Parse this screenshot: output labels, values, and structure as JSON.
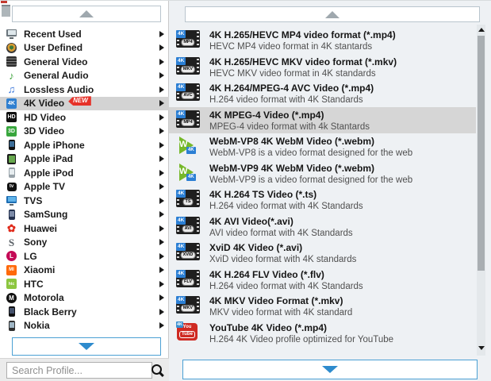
{
  "colors": {
    "accent_blue": "#3398dc",
    "chip_blue": "#2b7fd4",
    "selected_gray": "#d6d6d6",
    "badge_red": "#e63229",
    "panel_bg": "#eef1f4",
    "webm_green": "#76b82a",
    "youtube_red": "#cf2a22"
  },
  "left_panel": {
    "badge_new": "NEW",
    "search": {
      "placeholder": "Search Profile...",
      "icon": "search-icon"
    },
    "categories": [
      {
        "label": "Recent Used",
        "icon": "recent-used-icon",
        "kind": "monitor",
        "bg": "#6b757c",
        "screen": "#dfe8ec"
      },
      {
        "label": "User Defined",
        "icon": "user-defined-icon",
        "kind": "globe"
      },
      {
        "label": "General Video",
        "icon": "general-video-icon",
        "kind": "film"
      },
      {
        "label": "General Audio",
        "icon": "general-audio-icon",
        "kind": "note",
        "glyph": "♪",
        "fg": "#3fa33c"
      },
      {
        "label": "Lossless Audio",
        "icon": "lossless-audio-icon",
        "kind": "note",
        "glyph": "♫",
        "fg": "#2f6fd8"
      },
      {
        "label": "4K Video",
        "icon": "4k-video-icon",
        "kind": "square",
        "bg": "#2f7fd0",
        "glyph": "4K",
        "fsize": 7,
        "selected": true,
        "badge": "NEW"
      },
      {
        "label": "HD Video",
        "icon": "hd-video-icon",
        "kind": "square",
        "bg": "#101010",
        "glyph": "HD",
        "fsize": 7
      },
      {
        "label": "3D Video",
        "icon": "3d-video-icon",
        "kind": "square",
        "bg": "#38a63d",
        "glyph": "3D",
        "fsize": 7
      },
      {
        "label": "Apple iPhone",
        "icon": "apple-iphone-icon",
        "kind": "phone",
        "bg": "#101010",
        "screen": "#3d6e99"
      },
      {
        "label": "Apple iPad",
        "icon": "apple-ipad-icon",
        "kind": "tablet",
        "bg": "#1a1a1a",
        "screen": "#67a84e"
      },
      {
        "label": "Apple iPod",
        "icon": "apple-ipod-icon",
        "kind": "phone",
        "bg": "#98a2a9",
        "screen": "#e7edf0"
      },
      {
        "label": "Apple TV",
        "icon": "apple-tv-icon",
        "kind": "tvbox",
        "bg": "#101010",
        "glyph": "tv"
      },
      {
        "label": "TVS",
        "icon": "tvs-icon",
        "kind": "monitor",
        "bg": "#1d6db3",
        "screen": "#5fb2e8"
      },
      {
        "label": "SamSung",
        "icon": "samsung-icon",
        "kind": "phone",
        "bg": "#23304d",
        "screen": "#7c8ba8"
      },
      {
        "label": "Huawei",
        "icon": "huawei-icon",
        "kind": "note",
        "glyph": "✿",
        "fg": "#e02a1a"
      },
      {
        "label": "Sony",
        "icon": "sony-icon",
        "kind": "letter",
        "glyph": "S",
        "fg": "#5a6066"
      },
      {
        "label": "LG",
        "icon": "lg-icon",
        "kind": "circle",
        "bg": "#c40a56",
        "glyph": "L",
        "fsize": 8
      },
      {
        "label": "Xiaomi",
        "icon": "xiaomi-icon",
        "kind": "square",
        "bg": "#ff6909",
        "glyph": "MI",
        "fsize": 6
      },
      {
        "label": "HTC",
        "icon": "htc-icon",
        "kind": "square",
        "bg": "#8cc63f",
        "glyph": "htc",
        "fsize": 5
      },
      {
        "label": "Motorola",
        "icon": "motorola-icon",
        "kind": "circle",
        "bg": "#111111",
        "glyph": "M",
        "fsize": 8
      },
      {
        "label": "Black Berry",
        "icon": "black-berry-icon",
        "kind": "phone",
        "bg": "#101010",
        "screen": "#44516b"
      },
      {
        "label": "Nokia",
        "icon": "nokia-icon",
        "kind": "phone",
        "bg": "#2e2e2e",
        "screen": "#9fb6c5"
      }
    ]
  },
  "right_panel": {
    "formats": [
      {
        "title": "4K H.265/HEVC MP4 video format (*.mp4)",
        "subtitle": "HEVC MP4 video format in 4K stantards",
        "icon": "film",
        "fmt": "MP4"
      },
      {
        "title": "4K H.265/HEVC MKV video format (*.mkv)",
        "subtitle": "HEVC MKV video format in 4K standards",
        "icon": "film",
        "fmt": "MKV"
      },
      {
        "title": "4K H.264/MPEG-4 AVC Video (*.mp4)",
        "subtitle": "H.264 video format with 4K Standards",
        "icon": "film",
        "fmt": "AVC"
      },
      {
        "title": "4K MPEG-4 Video (*.mp4)",
        "subtitle": "MPEG-4 video format with 4k Stantards",
        "icon": "film",
        "fmt": "MP4",
        "selected": true
      },
      {
        "title": "WebM-VP8 4K WebM Video (*.webm)",
        "subtitle": "WebM-VP8 is a video format designed for the web",
        "icon": "webm"
      },
      {
        "title": "WebM-VP9 4K WebM Video (*.webm)",
        "subtitle": "WebM-VP9 is a video format designed for the web",
        "icon": "webm"
      },
      {
        "title": "4K H.264 TS Video (*.ts)",
        "subtitle": "H.264 video format with 4K Standards",
        "icon": "film",
        "fmt": "TS"
      },
      {
        "title": "4K AVI Video(*.avi)",
        "subtitle": "AVI video format with 4K Standards",
        "icon": "film",
        "fmt": "AVI"
      },
      {
        "title": "XviD 4K Video (*.avi)",
        "subtitle": "XviD video format with 4K standards",
        "icon": "film",
        "fmt": "XViD"
      },
      {
        "title": "4K H.264 FLV Video (*.flv)",
        "subtitle": "H.264 video format with 4K Standards",
        "icon": "film",
        "fmt": "FLV"
      },
      {
        "title": "4K MKV Video Format (*.mkv)",
        "subtitle": "MKV video format with 4K standard",
        "icon": "film",
        "fmt": "MKV"
      },
      {
        "title": "YouTube 4K Video (*.mp4)",
        "subtitle": "H.264 4K Video profile optimized for YouTube",
        "icon": "youtube",
        "yt_line1": "You",
        "yt_line2": "Tube"
      }
    ]
  }
}
